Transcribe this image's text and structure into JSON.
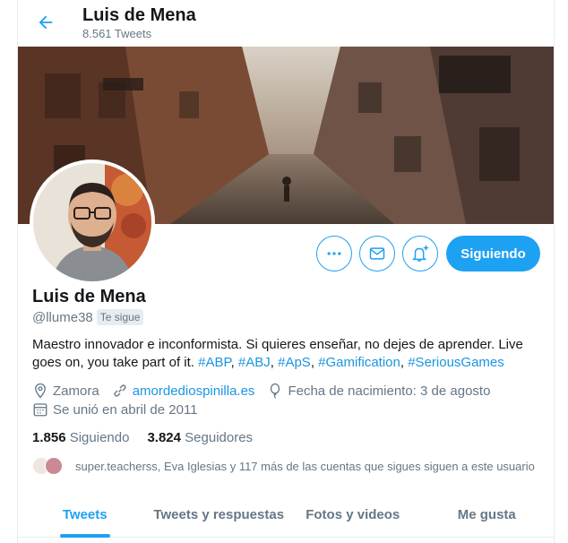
{
  "header": {
    "name": "Luis de Mena",
    "tweet_count": "8.561 Tweets"
  },
  "profile": {
    "name": "Luis de Mena",
    "handle": "@llume38",
    "follows_you": "Te sigue",
    "bio_text": "Maestro innovador e inconformista. Si quieres enseñar, no dejes de aprender. Live goes on, you take part of it.",
    "hashtags": [
      "#ABP",
      "#ABJ",
      "#ApS",
      "#Gamification",
      "#SeriousGames"
    ],
    "location": "Zamora",
    "website": "amordediospinilla.es",
    "birthday": "Fecha de nacimiento: 3 de agosto",
    "joined": "Se unió en abril de 2011"
  },
  "actions": {
    "follow_label": "Siguiendo",
    "more_icon": "more-icon",
    "message_icon": "mail-icon",
    "notify_icon": "bell-plus-icon"
  },
  "stats": {
    "following_count": "1.856",
    "following_label": "Siguiendo",
    "followers_count": "3.824",
    "followers_label": "Seguidores"
  },
  "followed_by": "super.teacherss, Eva Iglesias y 117 más de las cuentas que sigues siguen a este usuario",
  "tabs": [
    {
      "label": "Tweets",
      "active": true
    },
    {
      "label": "Tweets y respuestas",
      "active": false
    },
    {
      "label": "Fotos y videos",
      "active": false
    },
    {
      "label": "Me gusta",
      "active": false
    }
  ],
  "colors": {
    "accent": "#1da1f2",
    "link": "#1b95e0",
    "muted": "#657786"
  }
}
